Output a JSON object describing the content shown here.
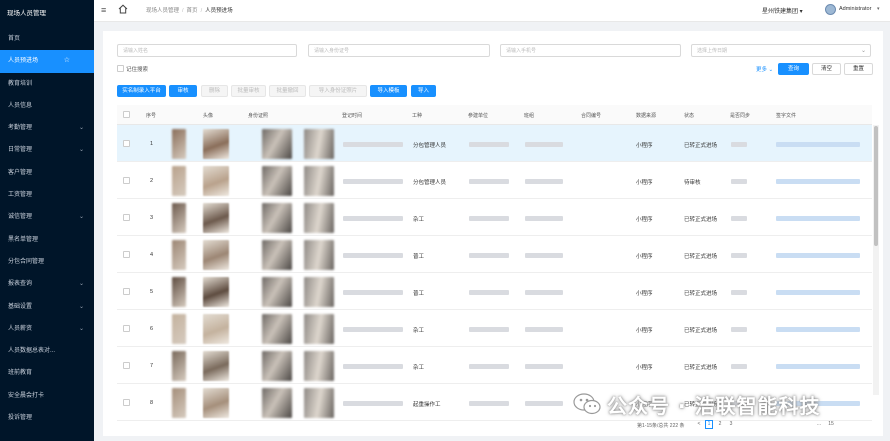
{
  "sidebar": {
    "brand": "现场人员管理",
    "items": [
      {
        "label": "首页",
        "chevron": false
      },
      {
        "label": "人员预进场",
        "chevron": false,
        "active": true
      },
      {
        "label": "教育培训",
        "chevron": false
      },
      {
        "label": "人员信息",
        "chevron": false
      },
      {
        "label": "考勤管理",
        "chevron": true
      },
      {
        "label": "日常管理",
        "chevron": true
      },
      {
        "label": "客户管理",
        "chevron": false
      },
      {
        "label": "工资管理",
        "chevron": false
      },
      {
        "label": "诚信管理",
        "chevron": true
      },
      {
        "label": "黑名单管理",
        "chevron": false
      },
      {
        "label": "分包合同管理",
        "chevron": false
      },
      {
        "label": "报表查询",
        "chevron": true
      },
      {
        "label": "基础设置",
        "chevron": true
      },
      {
        "label": "人员薪资",
        "chevron": true
      },
      {
        "label": "人员数据总表对...",
        "chevron": false
      },
      {
        "label": "班前教育",
        "chevron": false
      },
      {
        "label": "安全晨会打卡",
        "chevron": false
      },
      {
        "label": "投诉管理",
        "chevron": false
      }
    ]
  },
  "header": {
    "fold_icon": "≡",
    "breadcrumb": [
      "现场人员管理",
      "首页",
      "人员预进场"
    ],
    "project": "星州铁建集团",
    "user": "Administrator"
  },
  "filters": {
    "name_placeholder": "请输入姓名",
    "idcard_placeholder": "请输入身份证号",
    "phone_placeholder": "请输入手机号",
    "date_placeholder": "选择上传日期",
    "remember_label": "记住搜索",
    "more_label": "更多",
    "search_label": "查询",
    "clear_label": "清空",
    "reset_label": "重置"
  },
  "toolbar": {
    "buttons": [
      {
        "label": "实名制录入平台",
        "style": "blue"
      },
      {
        "label": "审核",
        "style": "blue"
      },
      {
        "label": "删除",
        "style": "disabled"
      },
      {
        "label": "批量审核",
        "style": "disabled"
      },
      {
        "label": "批量撤回",
        "style": "disabled"
      },
      {
        "label": "导入身份证照片",
        "style": "disabled"
      },
      {
        "label": "导入模板",
        "style": "blue"
      },
      {
        "label": "导入",
        "style": "blue"
      }
    ]
  },
  "table": {
    "columns": [
      "序号",
      "",
      "头像",
      "身份证照",
      "",
      "登记时间",
      "工种",
      "参建单位",
      "班组",
      "合同编号",
      "数据来源",
      "状态",
      "是否同步",
      "签字文件"
    ],
    "rows": [
      {
        "index": "1",
        "trade": "分包管理人员",
        "source": "小程序",
        "status": "已转正式进场"
      },
      {
        "index": "2",
        "trade": "分包管理人员",
        "source": "小程序",
        "status": "待审核"
      },
      {
        "index": "3",
        "trade": "杂工",
        "source": "小程序",
        "status": "已转正式进场"
      },
      {
        "index": "4",
        "trade": "普工",
        "source": "小程序",
        "status": "已转正式进场"
      },
      {
        "index": "5",
        "trade": "普工",
        "source": "小程序",
        "status": "已转正式进场"
      },
      {
        "index": "6",
        "trade": "杂工",
        "source": "小程序",
        "status": "已转正式进场"
      },
      {
        "index": "7",
        "trade": "杂工",
        "source": "小程序",
        "status": "已转正式进场"
      },
      {
        "index": "8",
        "trade": "起重操作工",
        "source": "小程序",
        "status": "已转正式进场"
      }
    ]
  },
  "pagination": {
    "summary": "第1-15条/总共 222 条",
    "prev": "<",
    "pages": [
      "1",
      "2",
      "3"
    ],
    "ellipsis": "...",
    "last": "15"
  },
  "watermark": {
    "text": "公众号 · 浩联智能科技"
  },
  "colors": {
    "sidebar_bg": "#001529",
    "accent": "#1890ff",
    "highlight_row": "#e6f4fd"
  }
}
